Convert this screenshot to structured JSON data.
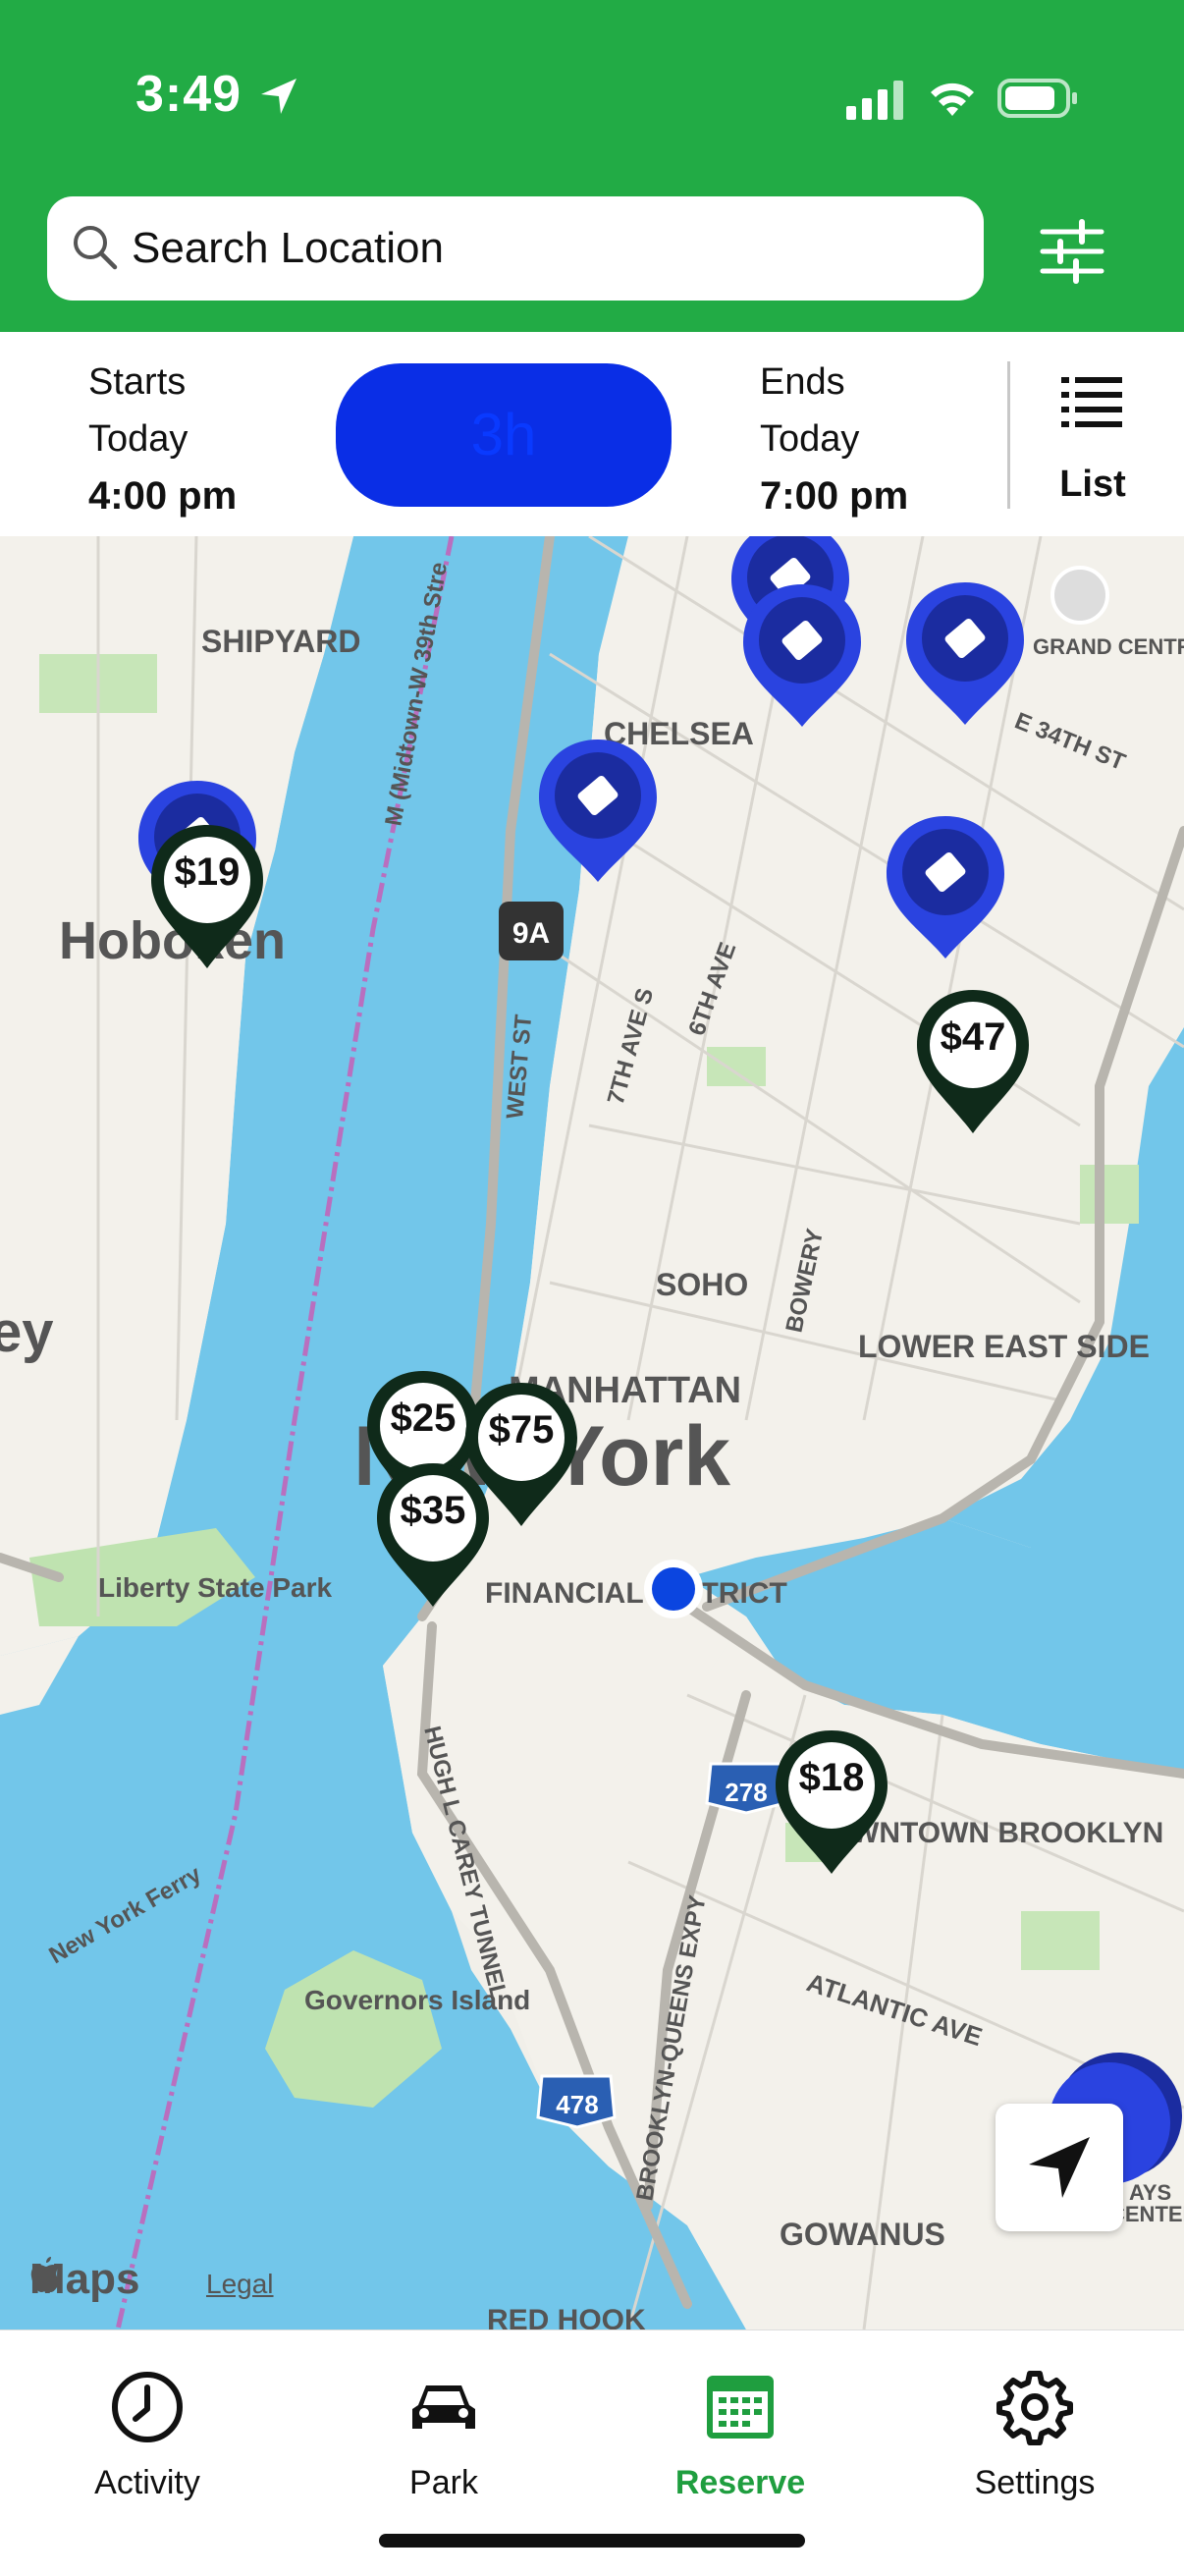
{
  "status_bar": {
    "time": "3:49"
  },
  "search": {
    "placeholder": "Search Location"
  },
  "time_bar": {
    "starts_label": "Starts",
    "starts_day": "Today",
    "starts_time": "4:00 pm",
    "duration": "3h",
    "ends_label": "Ends",
    "ends_day": "Today",
    "ends_time": "7:00 pm",
    "list_label": "List"
  },
  "map": {
    "labels": {
      "shipyard": "SHIPYARD",
      "chelsea": "CHELSEA",
      "hoboken": "Hoboken",
      "grand_central": "GRAND CENTRAL TERMINAL",
      "soho": "SOHO",
      "lower_east_side": "LOWER EAST SIDE",
      "manhattan": "MANHATTAN",
      "new_york": "New York",
      "financial_district": "FINANCIAL DISTRICT",
      "liberty_state_park": "Liberty State Park",
      "governors_island": "Governors Island",
      "downtown_brooklyn": "DOWNTOWN BROOKLYN",
      "gowanus": "GOWANUS",
      "red_hook": "RED HOOK",
      "atlantic_ave": "ATLANTIC AVE",
      "west_st": "WEST ST",
      "seventh_ave": "7TH AVE S",
      "sixth_ave": "6TH AVE",
      "bowery": "BOWERY",
      "hugh_carey": "HUGH L CAREY TUNNEL",
      "bqe": "BROOKLYN-QUEENS EXPY",
      "ny_ferry": "New York Ferry",
      "midtown_w39": "M (Midtown-W 39th Stre",
      "e34th": "E 34TH ST",
      "route_9a": "9A",
      "i278": "278",
      "i478": "478",
      "ey": "ey",
      "centre": "CENTER",
      "ays": "AYS"
    },
    "price_pins": [
      "$19",
      "$47",
      "$25",
      "$75",
      "$35",
      "$18"
    ],
    "maps_brand": "Maps",
    "legal": "Legal"
  },
  "tabs": [
    {
      "label": "Activity"
    },
    {
      "label": "Park"
    },
    {
      "label": "Reserve"
    },
    {
      "label": "Settings"
    }
  ],
  "colors": {
    "header_green": "#22ab45",
    "active_green": "#1f9e3f",
    "pin_blue": "#2a43e0",
    "duration_blue": "#0a2ee6"
  }
}
